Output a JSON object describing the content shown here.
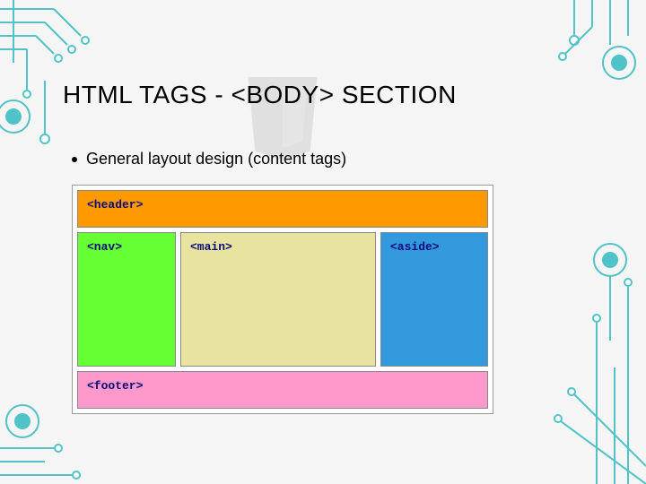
{
  "title": "HTML TAGS - <BODY> SECTION",
  "bullet": "General layout design (content tags)",
  "diagram": {
    "header": "<header>",
    "nav": "<nav>",
    "main": "<main>",
    "aside": "<aside>",
    "footer": "<footer>"
  },
  "colors": {
    "header": "#ff9900",
    "nav": "#66ff33",
    "main": "#e8e4a0",
    "aside": "#3399dd",
    "footer": "#ff99cc",
    "circuit": "#4fc3c7"
  }
}
